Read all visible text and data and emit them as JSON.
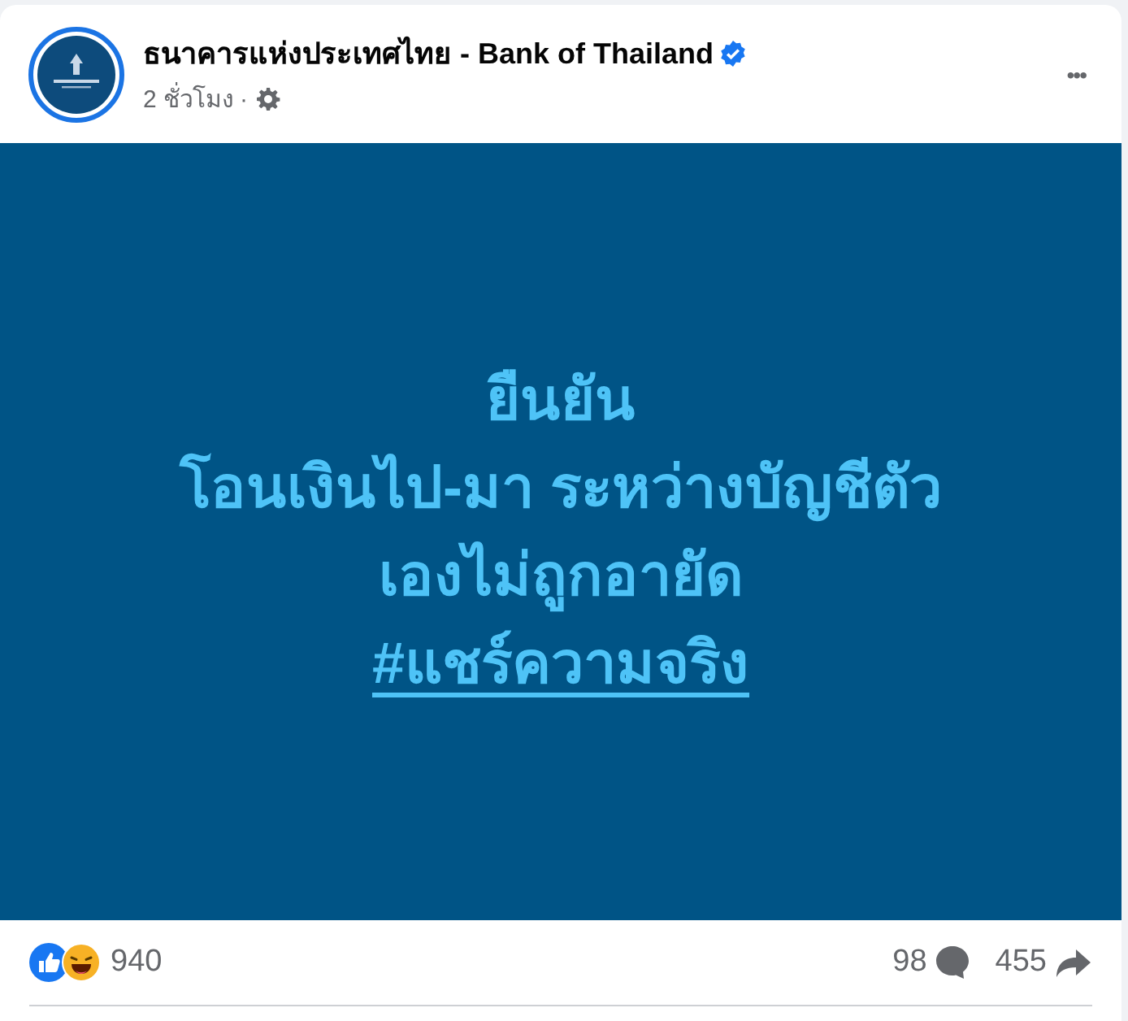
{
  "post": {
    "page_name": "ธนาคารแห่งประเทศไทย - Bank of Thailand",
    "verified": true,
    "time": "2 ชั่วโมง",
    "separator": "·",
    "menu": "•••",
    "image_lines": [
      {
        "kind": "text",
        "text": "ยืนยัน"
      },
      {
        "kind": "text",
        "text": "โอนเงินไป-มา ระหว่างบัญชีตัว"
      },
      {
        "kind": "text",
        "text": "เองไม่ถูกอายัด"
      },
      {
        "kind": "hashtag",
        "text": "#แชร์ความจริง"
      }
    ],
    "reactions": {
      "count": "940"
    },
    "comments": {
      "count": "98"
    },
    "shares": {
      "count": "455"
    }
  }
}
